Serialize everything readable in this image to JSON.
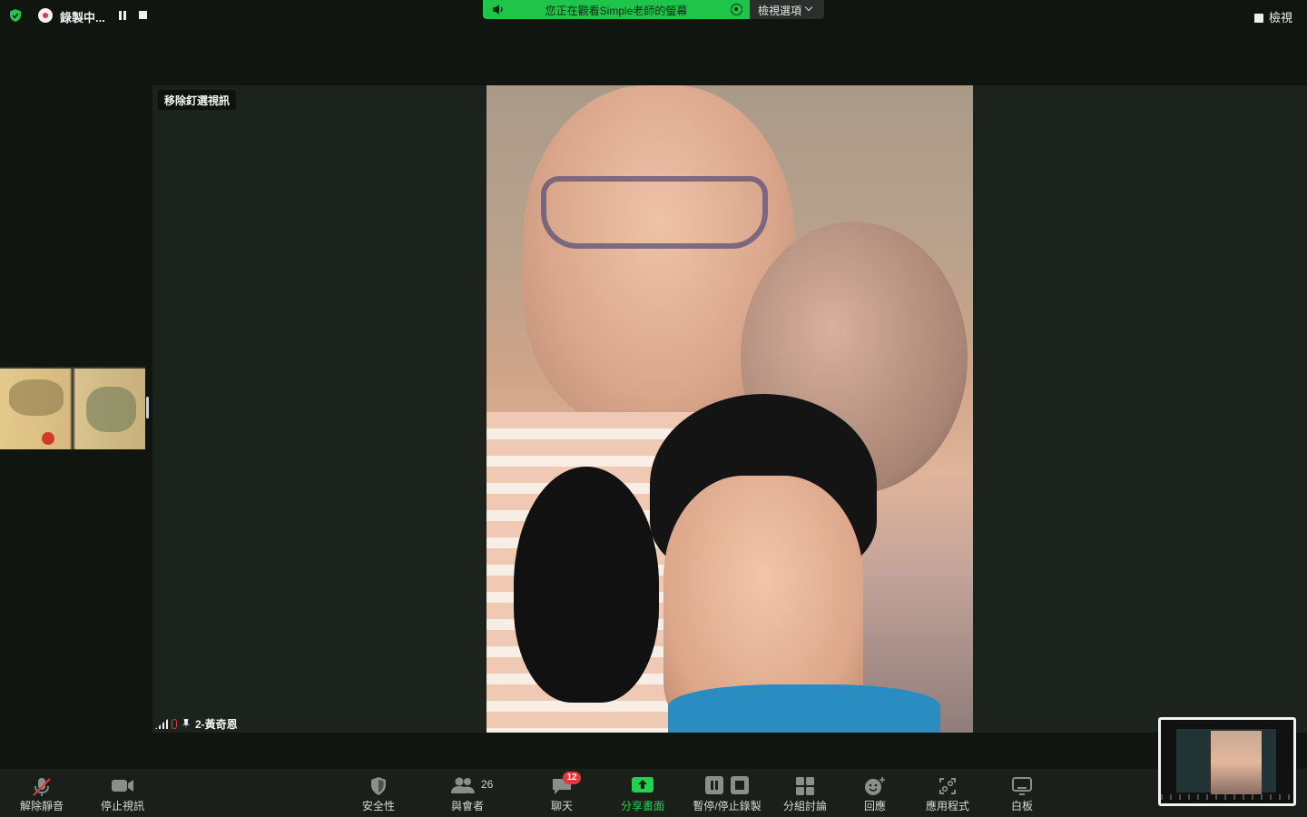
{
  "topbar": {
    "recording_label": "錄製中...",
    "banner_text": "您正在觀看Simple老師的螢幕",
    "view_options_label": "檢視選項",
    "view_label": "檢視"
  },
  "stage": {
    "unpin_label": "移除釘選視訊",
    "participant_name": "2-黃奇恩"
  },
  "toolbar": {
    "unmute": "解除靜音",
    "stop_video": "停止視訊",
    "security": "安全性",
    "participants": "與會者",
    "participants_count": "26",
    "chat": "聊天",
    "chat_badge": "12",
    "share_screen": "分享畫面",
    "pause_stop_recording": "暫停/停止錄製",
    "breakout_rooms": "分組討論",
    "reactions": "回應",
    "apps": "應用程式",
    "whiteboard": "白板"
  },
  "colors": {
    "accent_green": "#22d24f",
    "banner_green": "#1fc44a",
    "badge_red": "#e0383e",
    "background": "#101510"
  },
  "icons": [
    "shield-check-icon",
    "record-icon",
    "pause-icon",
    "stop-icon",
    "speaker-icon",
    "target-icon",
    "chevron-down-icon",
    "view-icon",
    "signal-icon",
    "mic-off-icon",
    "pin-icon",
    "mic-icon",
    "video-camera-icon",
    "security-shield-icon",
    "participants-icon",
    "chat-icon",
    "share-arrow-icon",
    "pause-stop-icon",
    "breakout-grid-icon",
    "reaction-smile-icon",
    "apps-icon",
    "whiteboard-icon"
  ]
}
